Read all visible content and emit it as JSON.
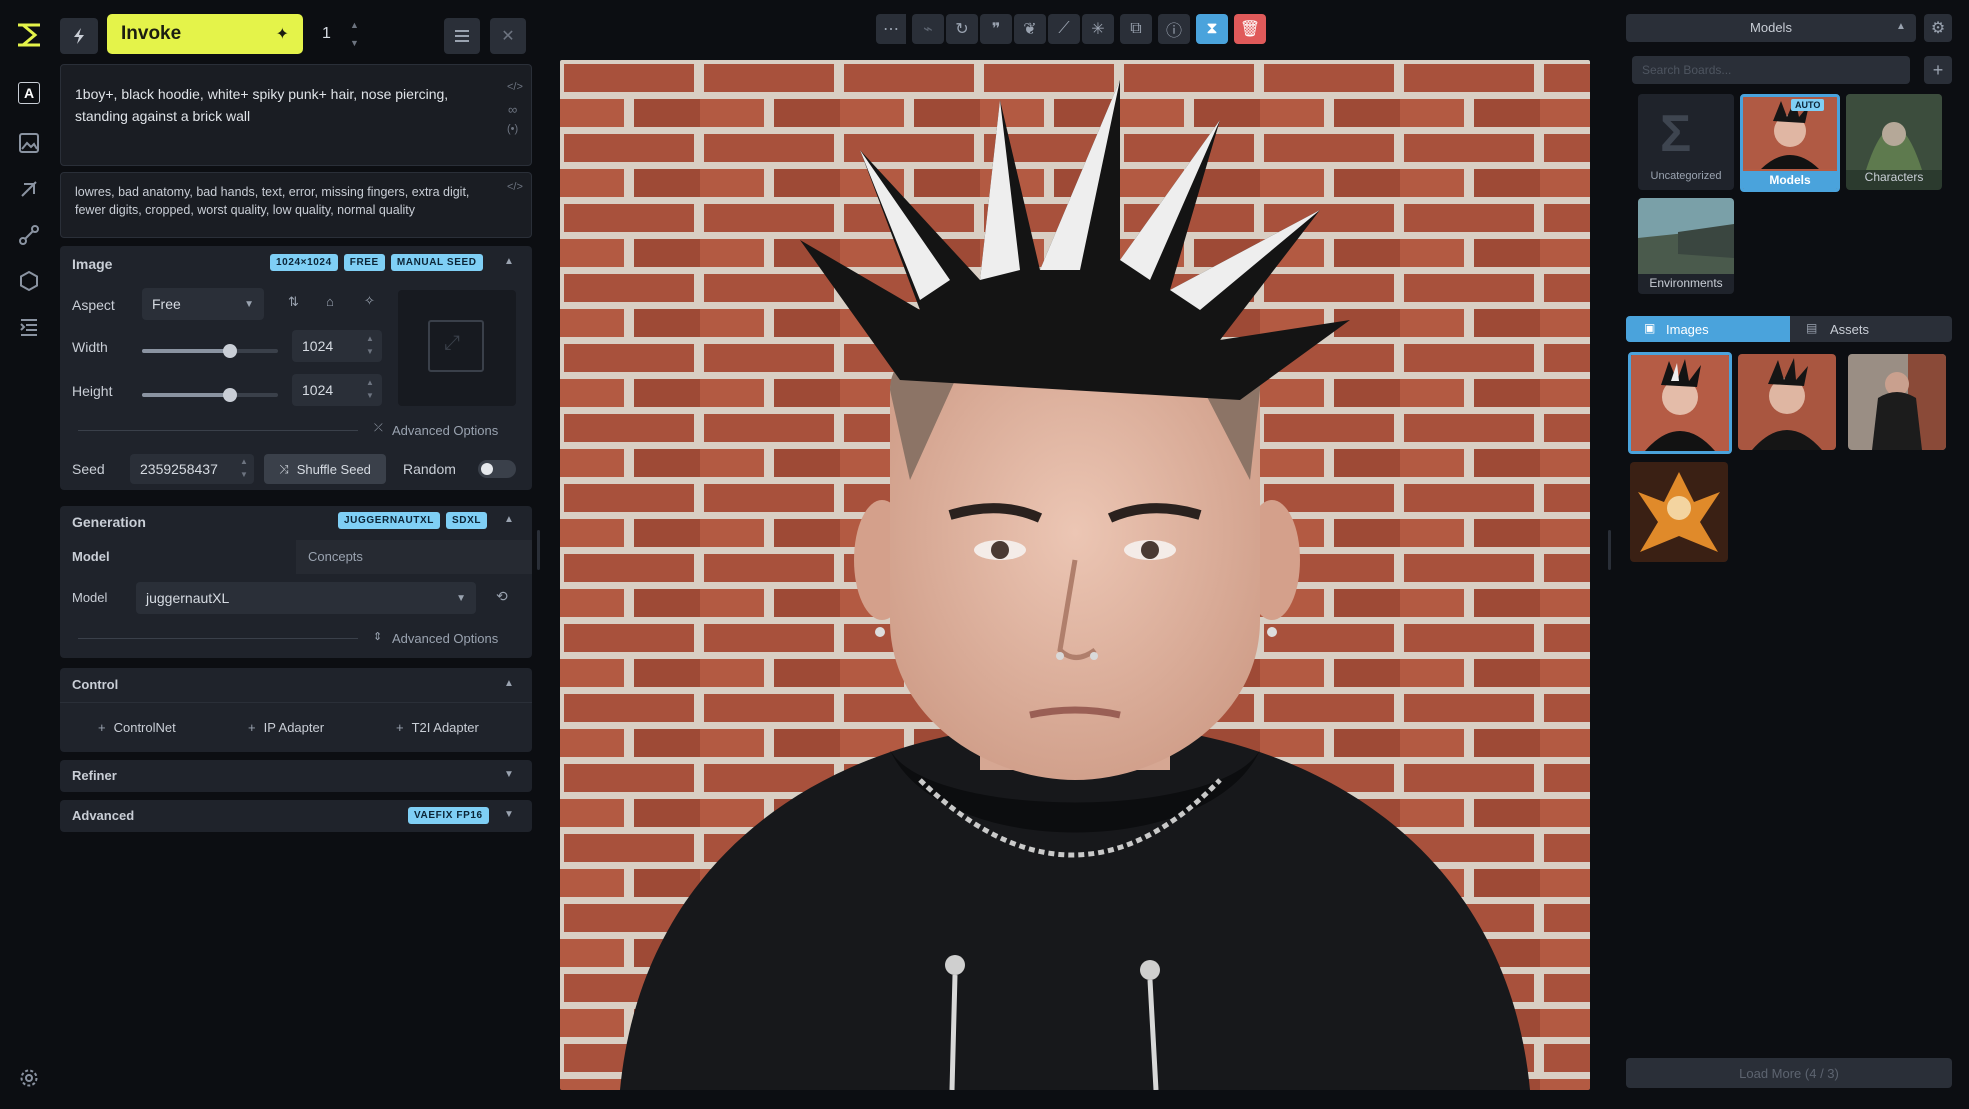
{
  "topbar": {
    "invoke_label": "Invoke",
    "count": "1"
  },
  "prompts": {
    "positive": "1boy+, black hoodie, white+ spiky punk+ hair, nose piercing, standing against a brick wall",
    "negative": "lowres, bad anatomy, bad hands, text, error, missing fingers, extra digit, fewer digits, cropped, worst quality, low quality, normal quality"
  },
  "image_section": {
    "title": "Image",
    "badges": [
      "1024×1024",
      "FREE",
      "MANUAL SEED"
    ],
    "aspect_label": "Aspect",
    "aspect_value": "Free",
    "width_label": "Width",
    "width_value": "1024",
    "height_label": "Height",
    "height_value": "1024",
    "advanced_options": "Advanced Options",
    "seed_label": "Seed",
    "seed_value": "2359258437",
    "shuffle_label": "Shuffle Seed",
    "random_label": "Random",
    "width_fraction": 0.64,
    "height_fraction": 0.64
  },
  "generation": {
    "title": "Generation",
    "badges": [
      "JUGGERNAUTXL",
      "SDXL"
    ],
    "tab_model": "Model",
    "tab_concepts": "Concepts",
    "model_label": "Model",
    "model_value": "juggernautXL",
    "advanced_options": "Advanced Options"
  },
  "control": {
    "title": "Control",
    "controlnet": "ControlNet",
    "ip_adapter": "IP Adapter",
    "t2i_adapter": "T2I Adapter"
  },
  "refiner": {
    "title": "Refiner"
  },
  "advanced": {
    "title": "Advanced",
    "badge": "VAEFIX FP16"
  },
  "boards": {
    "header": "Models",
    "search_placeholder": "Search Boards...",
    "items": [
      {
        "label": "Uncategorized"
      },
      {
        "label": "Models",
        "badge": "AUTO"
      },
      {
        "label": "Characters"
      },
      {
        "label": "Environments"
      }
    ]
  },
  "gallery": {
    "tab_images": "Images",
    "tab_assets": "Assets",
    "load_more": "Load More (4 / 3)"
  },
  "colors": {
    "accent_yellow": "#e4f34a",
    "accent_blue": "#4aa3dc",
    "badge_blue": "#7fcff5",
    "danger_red": "#e05a5a"
  },
  "icons": [
    "logo-icon",
    "text-icon",
    "image-icon",
    "canvas-icon",
    "workflow-icon",
    "model-icon",
    "queue-icon",
    "settings-icon"
  ]
}
